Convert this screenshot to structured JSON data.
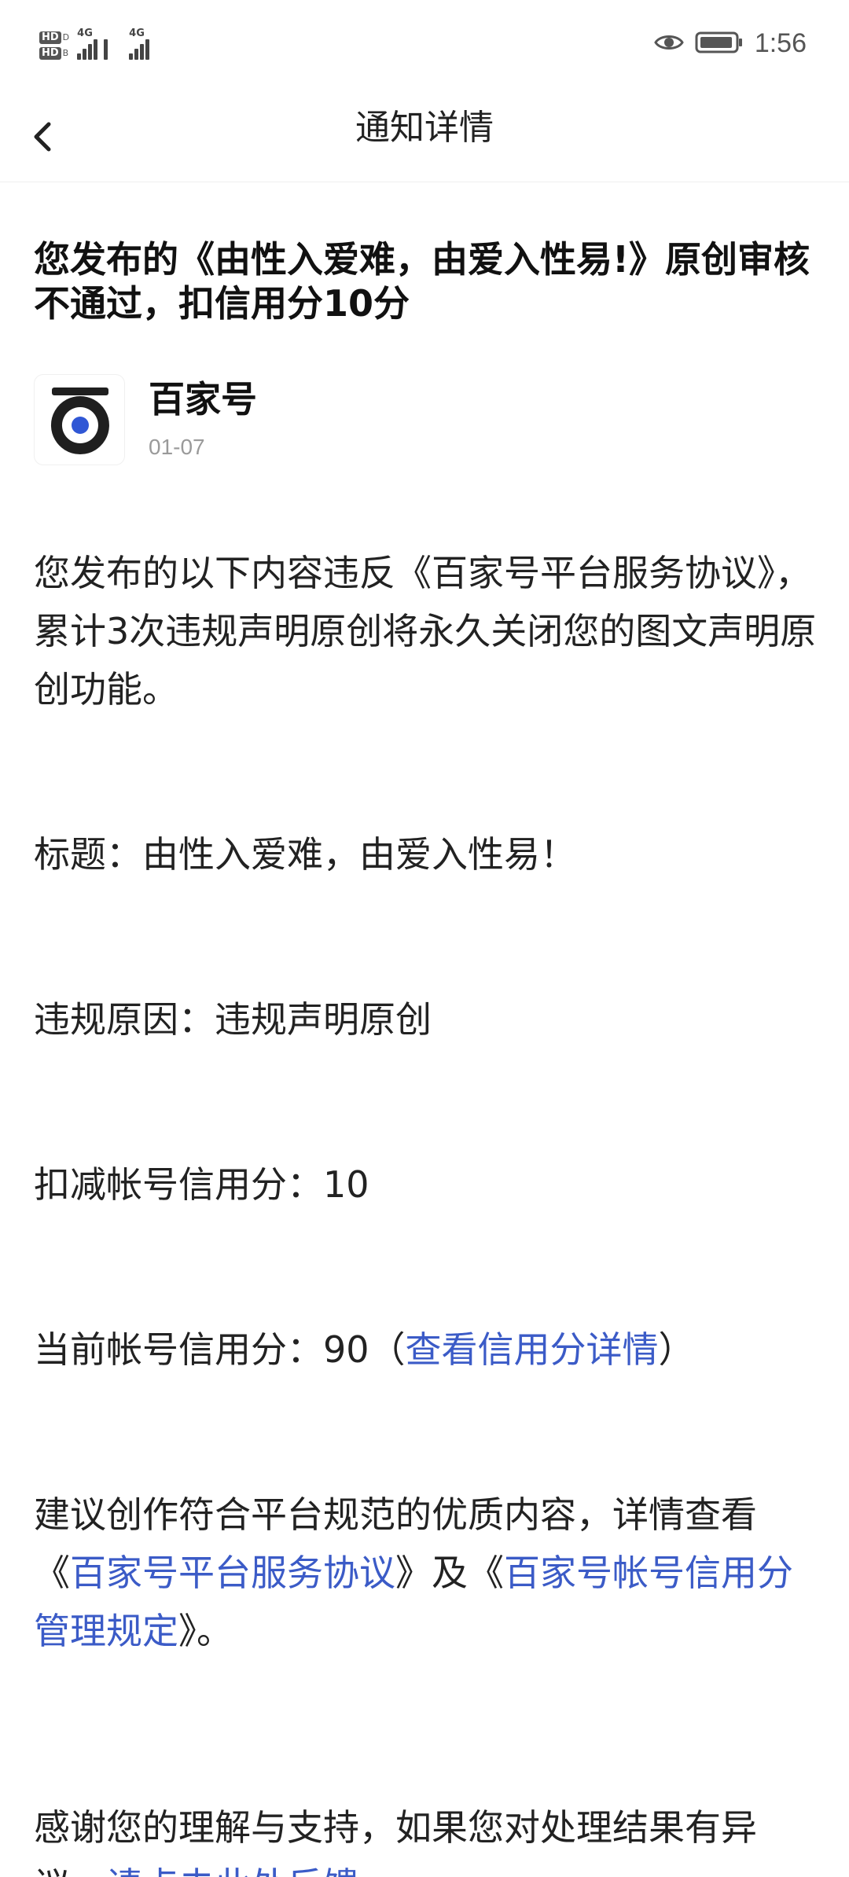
{
  "status_bar": {
    "hd_label": "HD",
    "network_1": "4G",
    "network_2": "4G",
    "time": "1:56"
  },
  "header": {
    "title": "通知详情"
  },
  "notice": {
    "title": "您发布的《由性入爱难，由爱入性易!》原创审核不通过，扣信用分10分",
    "source_name": "百家号",
    "date": "01-07",
    "intro": "您发布的以下内容违反《百家号平台服务协议》，累计3次违规声明原创将永久关闭您的图文声明原创功能。",
    "title_line": "标题：由性入爱难，由爱入性易！",
    "reason_line": "违规原因：违规声明原创",
    "deduct_line": "扣减帐号信用分：10",
    "current_prefix": "当前帐号信用分：90（",
    "current_link": "查看信用分详情",
    "current_suffix": "）",
    "suggest_prefix": "建议创作符合平台规范的优质内容，详情查看《",
    "suggest_link_1": "百家号平台服务协议",
    "suggest_middle": "》及《",
    "suggest_link_2": "百家号帐号信用分管理规定",
    "suggest_suffix": "》。",
    "thanks_line": "感谢您的理解与支持，如果您对处理结果有异",
    "thanks_line_2_prefix": "议，",
    "thanks_line_2_link": "请点击此处反馈"
  },
  "colors": {
    "link": "#3b5bc7",
    "logo_dark": "#1f1f1f",
    "logo_accent": "#3057d5",
    "date_gray": "#9a9a9a"
  },
  "icons": {
    "back": "chevron-left-icon",
    "eye": "eye-icon",
    "battery": "battery-icon"
  }
}
